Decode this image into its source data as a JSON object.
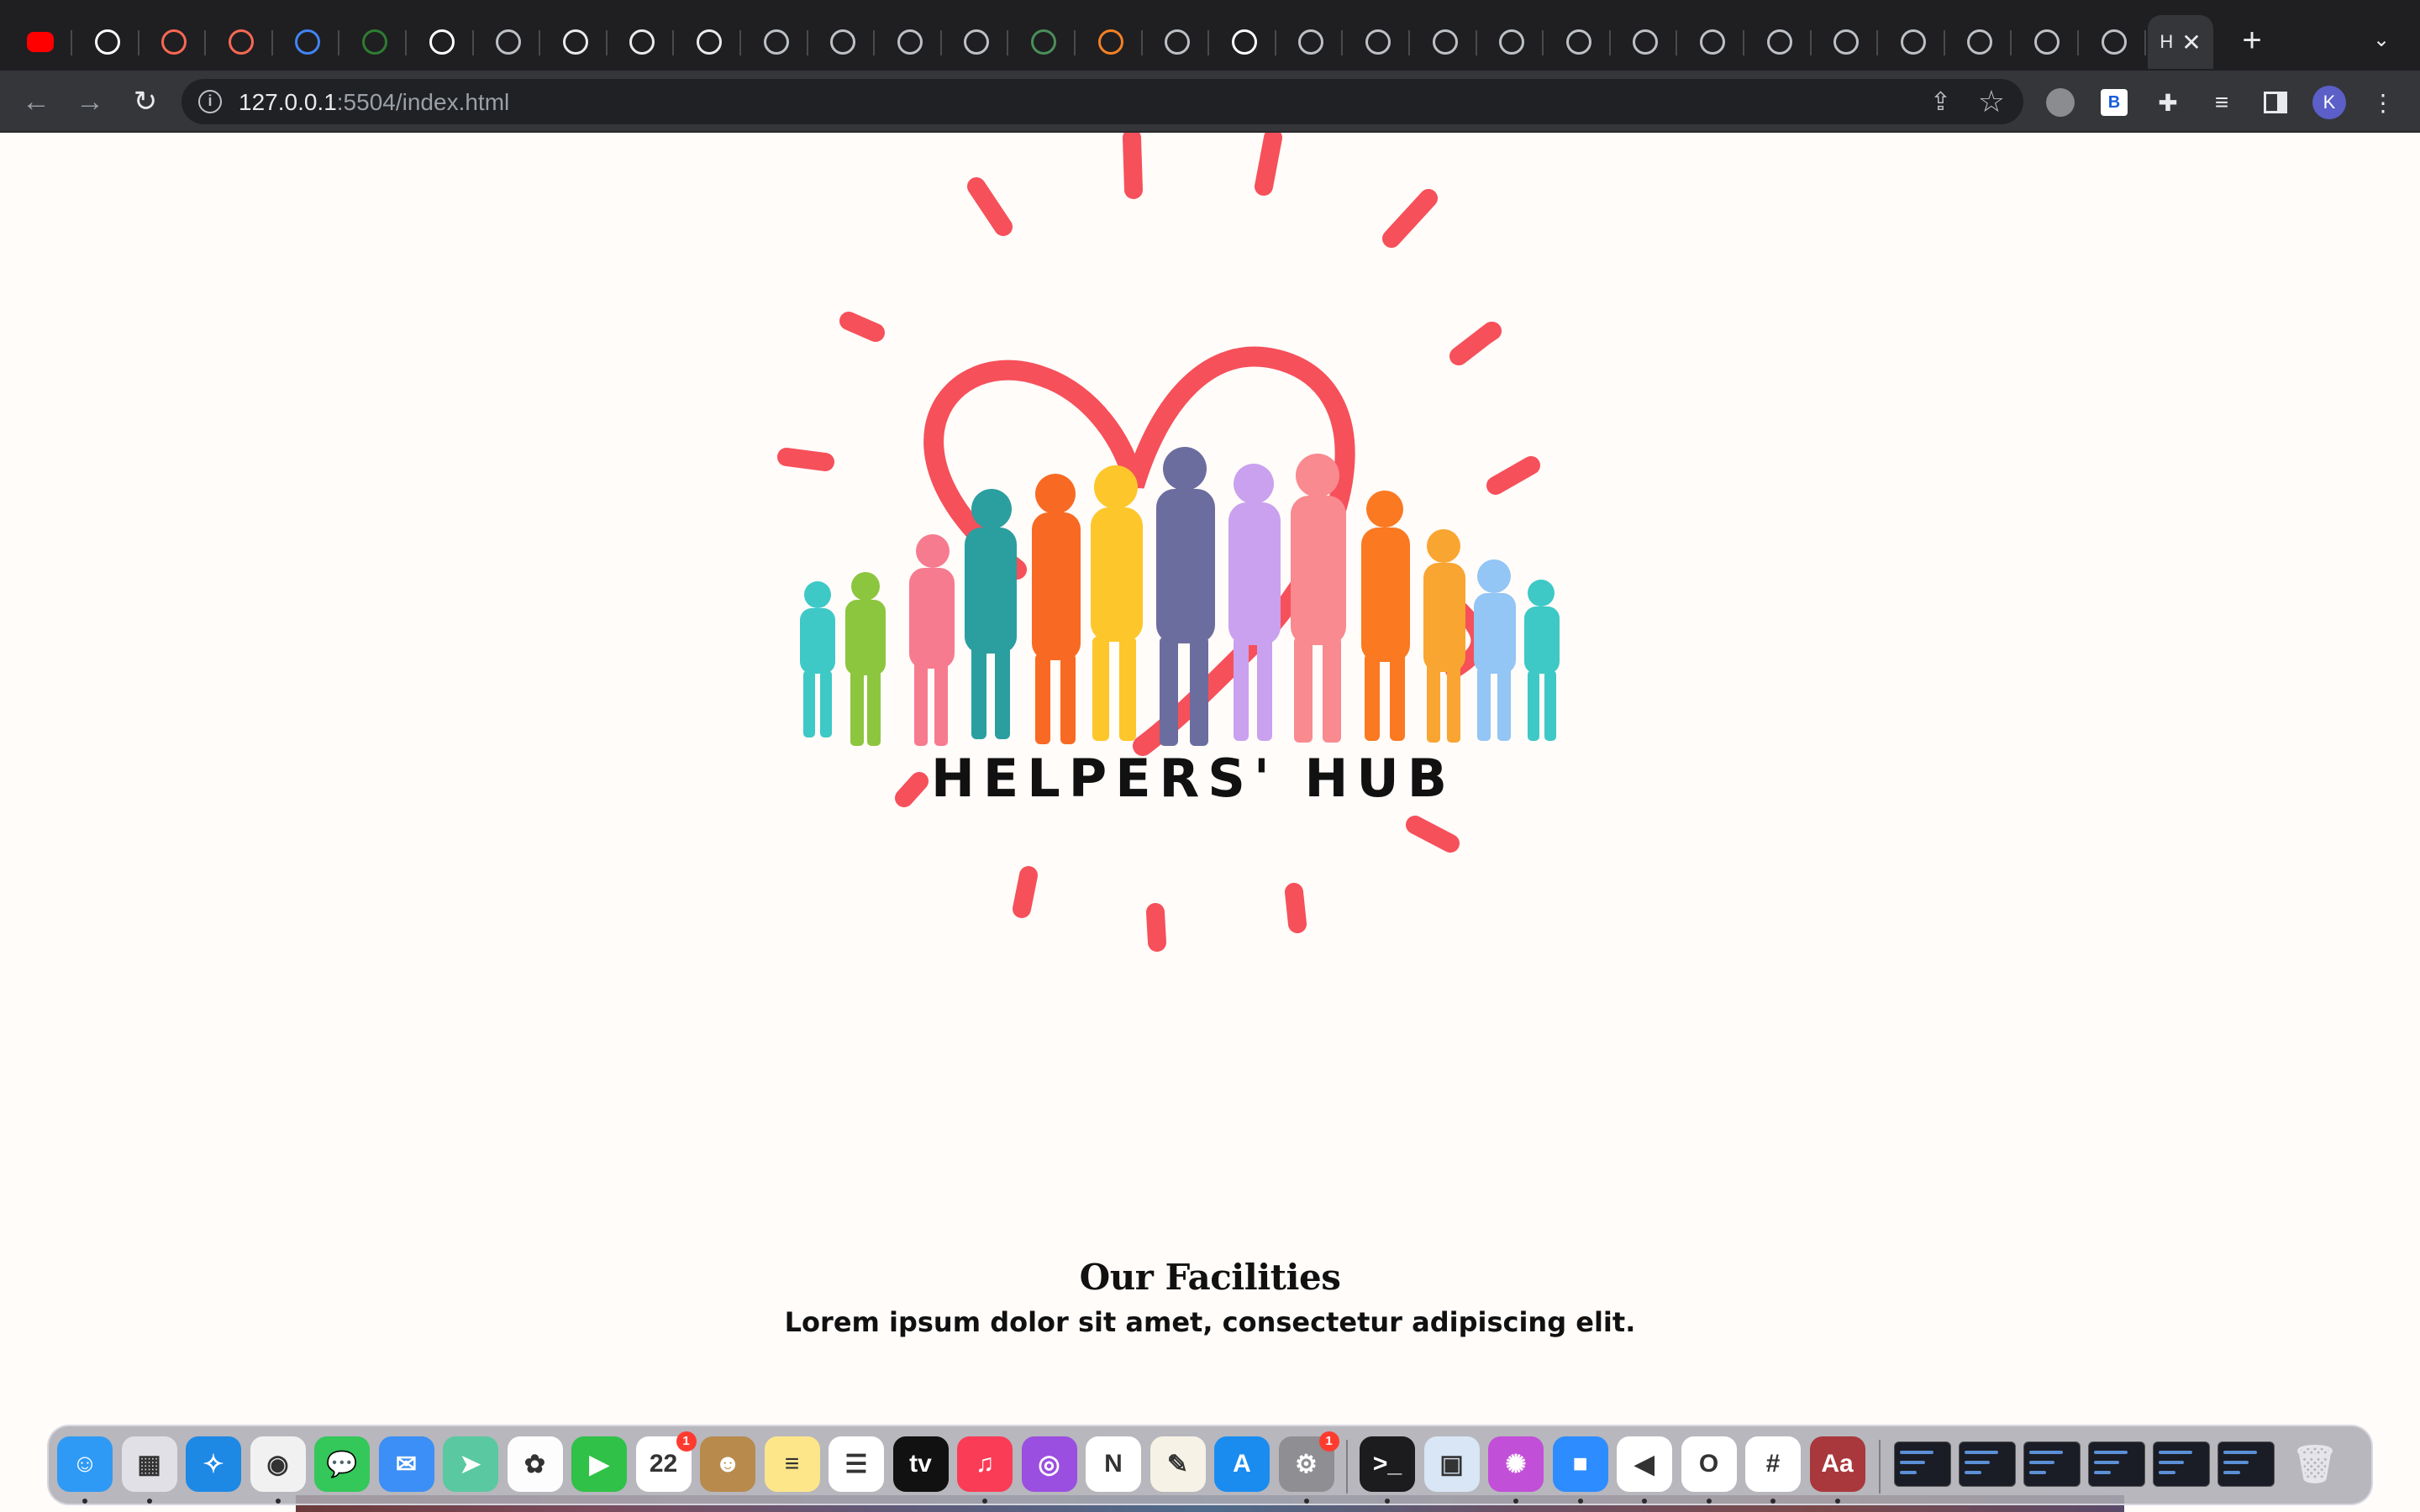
{
  "browser": {
    "tabs": [
      {
        "icon": "youtube-icon",
        "color": "#ff0000"
      },
      {
        "icon": "github-icon",
        "color": "#ffffff"
      },
      {
        "icon": "patreon-icon",
        "color": "#f96854"
      },
      {
        "icon": "patreon-icon",
        "color": "#f96854"
      },
      {
        "icon": "google-icon",
        "color": "#4285f4"
      },
      {
        "icon": "infinity-icon",
        "color": "#2e7d32"
      },
      {
        "icon": "openai-icon",
        "color": "#ffffff"
      },
      {
        "icon": "globe-icon",
        "color": "#bdc1c6"
      },
      {
        "icon": "document-icon",
        "color": "#e8eaed"
      },
      {
        "icon": "document-icon",
        "color": "#e8eaed"
      },
      {
        "icon": "chrome-icon",
        "color": "#e8eaed"
      },
      {
        "icon": "globe-icon",
        "color": "#bdc1c6"
      },
      {
        "icon": "globe-icon",
        "color": "#bdc1c6"
      },
      {
        "icon": "globe-icon",
        "color": "#bdc1c6"
      },
      {
        "icon": "globe-icon",
        "color": "#bdc1c6"
      },
      {
        "icon": "earth-icon",
        "color": "#4a8f5a"
      },
      {
        "icon": "stackoverflow-icon",
        "color": "#f48024"
      },
      {
        "icon": "globe-icon",
        "color": "#bdc1c6"
      },
      {
        "icon": "openai-icon",
        "color": "#ffffff"
      },
      {
        "icon": "globe-icon",
        "color": "#bdc1c6"
      },
      {
        "icon": "globe-icon",
        "color": "#bdc1c6"
      },
      {
        "icon": "globe-icon",
        "color": "#bdc1c6"
      },
      {
        "icon": "globe-icon",
        "color": "#bdc1c6"
      },
      {
        "icon": "globe-icon",
        "color": "#bdc1c6"
      },
      {
        "icon": "globe-icon",
        "color": "#bdc1c6"
      },
      {
        "icon": "globe-icon",
        "color": "#bdc1c6"
      },
      {
        "icon": "globe-icon",
        "color": "#bdc1c6"
      },
      {
        "icon": "globe-icon",
        "color": "#bdc1c6"
      },
      {
        "icon": "globe-icon",
        "color": "#bdc1c6"
      },
      {
        "icon": "globe-icon",
        "color": "#bdc1c6"
      },
      {
        "icon": "globe-icon",
        "color": "#bdc1c6"
      },
      {
        "icon": "globe-icon",
        "color": "#bdc1c6"
      }
    ],
    "active_tab": {
      "title": "H",
      "close": "✕"
    },
    "new_tab": "+",
    "tab_search": "⌄",
    "url_host": "127.0.0.1",
    "url_path": ":5504/index.html",
    "profile_initial": "K"
  },
  "page": {
    "logo": {
      "text": "HELPERS' HUB",
      "accent_color": "#f6505a"
    },
    "facilities": {
      "heading": "Our Facilities",
      "subheading": "Lorem ipsum dolor sit amet, consectetur adipiscing elit."
    }
  },
  "dock": {
    "apps": [
      {
        "name": "finder",
        "color": "#2f9af5",
        "glyph": "☺",
        "dot": true
      },
      {
        "name": "launchpad",
        "color": "#e0e0e6",
        "glyph": "▦",
        "dot": true
      },
      {
        "name": "safari",
        "color": "#1e88e5",
        "glyph": "✧",
        "dot": false
      },
      {
        "name": "chrome",
        "color": "#f1f1f1",
        "glyph": "◉",
        "dot": true
      },
      {
        "name": "messages",
        "color": "#34c759",
        "glyph": "💬",
        "dot": false
      },
      {
        "name": "mail",
        "color": "#3b8ff6",
        "glyph": "✉",
        "dot": false
      },
      {
        "name": "maps",
        "color": "#5ac8a0",
        "glyph": "➤",
        "dot": false
      },
      {
        "name": "photos",
        "color": "#fdfdfd",
        "glyph": "✿",
        "dot": false
      },
      {
        "name": "facetime",
        "color": "#30c148",
        "glyph": "▶",
        "dot": false
      },
      {
        "name": "calendar",
        "color": "#ffffff",
        "glyph": "22",
        "badge": "1",
        "dot": false
      },
      {
        "name": "contacts",
        "color": "#b88a4c",
        "glyph": "☻",
        "dot": false
      },
      {
        "name": "notes",
        "color": "#fde68a",
        "glyph": "≡",
        "dot": false
      },
      {
        "name": "reminders",
        "color": "#ffffff",
        "glyph": "☰",
        "dot": false
      },
      {
        "name": "apple-tv",
        "color": "#111111",
        "glyph": "tv",
        "dot": false
      },
      {
        "name": "music",
        "color": "#fb3c57",
        "glyph": "♫",
        "dot": true
      },
      {
        "name": "podcasts",
        "color": "#9b4fe0",
        "glyph": "◎",
        "dot": false
      },
      {
        "name": "news",
        "color": "#ffffff",
        "glyph": "N",
        "dot": false
      },
      {
        "name": "pages",
        "color": "#f7f2e6",
        "glyph": "✎",
        "dot": false
      },
      {
        "name": "app-store",
        "color": "#1a8cf0",
        "glyph": "A",
        "dot": false
      },
      {
        "name": "system-settings",
        "color": "#8e8e93",
        "glyph": "⚙",
        "badge": "1",
        "dot": true
      },
      {
        "name": "terminal",
        "color": "#1c1c1e",
        "glyph": ">_",
        "dot": true
      },
      {
        "name": "preview",
        "color": "#d8e6f5",
        "glyph": "▣",
        "dot": false
      },
      {
        "name": "flower-app",
        "color": "#c24fd8",
        "glyph": "✺",
        "dot": true
      },
      {
        "name": "zoom",
        "color": "#2d8cff",
        "glyph": "■",
        "dot": true
      },
      {
        "name": "vscode",
        "color": "#ffffff",
        "glyph": "◀",
        "dot": true
      },
      {
        "name": "outlook",
        "color": "#ffffff",
        "glyph": "O",
        "dot": true
      },
      {
        "name": "slack",
        "color": "#ffffff",
        "glyph": "#",
        "dot": true
      },
      {
        "name": "dictionary",
        "color": "#a8383b",
        "glyph": "Aa",
        "dot": true
      }
    ],
    "windows": [
      "chrome-window",
      "apple-tv-window",
      "vscode-window",
      "finder-window",
      "chrome-window",
      "vscode-window"
    ],
    "trash": "trash-icon"
  }
}
